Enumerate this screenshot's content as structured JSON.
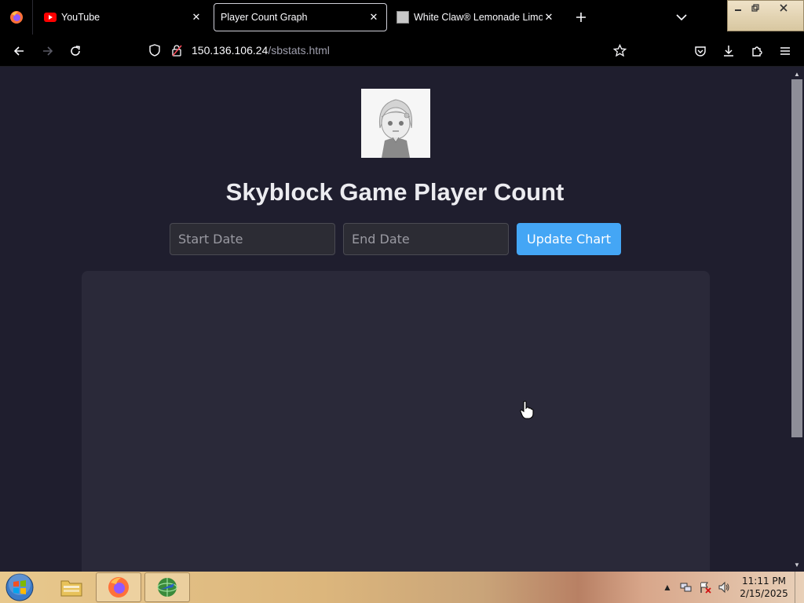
{
  "browser": {
    "tabs": [
      {
        "title": "YouTube",
        "icon": "youtube-icon",
        "active": false
      },
      {
        "title": "Player Count Graph",
        "icon": "",
        "active": true
      },
      {
        "title": "White Claw® Lemonade Limonade",
        "icon": "favicon-image",
        "active": false
      }
    ],
    "url_host": "150.136.106.24",
    "url_path": "/sbstats.html"
  },
  "page": {
    "title": "Skyblock Game Player Count",
    "start_date_placeholder": "Start Date",
    "end_date_placeholder": "End Date",
    "update_button": "Update Chart"
  },
  "taskbar": {
    "time": "11:11 PM",
    "date": "2/15/2025"
  },
  "colors": {
    "page_bg": "#1f1e2e",
    "panel_bg": "#2a2939",
    "button_bg": "#44a6f5"
  }
}
